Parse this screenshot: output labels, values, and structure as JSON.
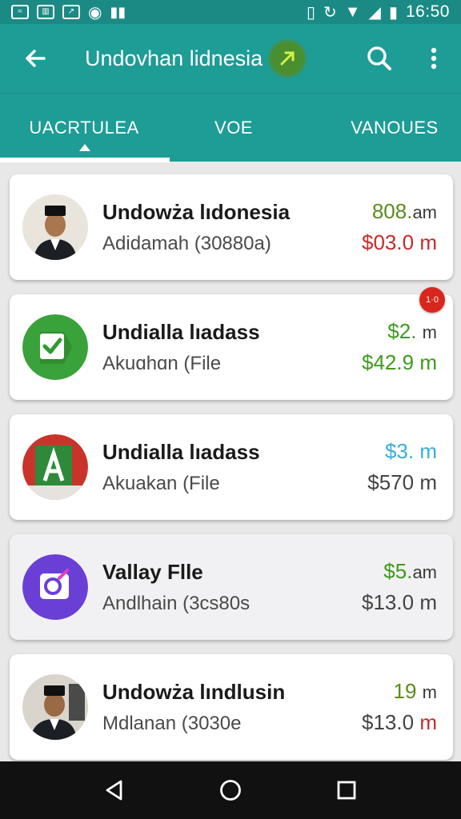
{
  "status_bar": {
    "time": "16:50",
    "left_icons": [
      "notification-icon",
      "newspaper-icon",
      "chart-icon",
      "music-icon",
      "bar-chart-icon"
    ],
    "right_icons": [
      "vibrate-icon",
      "sync-icon",
      "wifi-icon",
      "signal-icon",
      "battery-icon"
    ]
  },
  "app_bar": {
    "title": "Undovhan lidnesia",
    "back_icon": "arrow-left-icon",
    "badge_icon": "arrow-up-right-icon",
    "search_icon": "search-icon",
    "more_icon": "more-vert-icon"
  },
  "tabs": [
    {
      "label": "UACRTULEA",
      "selected": true
    },
    {
      "label": "VOE",
      "selected": false
    },
    {
      "label": "VANOUES",
      "selected": false
    }
  ],
  "list": [
    {
      "title": "Undowża lıdonesia",
      "subtitle": "Adidamah (30880a)",
      "value_top": "808.",
      "value_top_unit": "am",
      "value_bottom": "$03.0",
      "value_bottom_unit": "m",
      "avatar": "person-photo",
      "top_color": "#5b8b1e",
      "bottom_color": "#c92a2a"
    },
    {
      "title": "Undialla lıadass",
      "subtitle": "Akuɑhɑn (File",
      "value_top": "$2.",
      "value_top_unit": "m",
      "value_bottom": "$42.9",
      "value_bottom_unit": "m",
      "avatar": "green-check-icon",
      "badge": "1·0",
      "top_color": "#3f9a1c",
      "bottom_color": "#3f9a1c"
    },
    {
      "title": "Undialla lıadass",
      "subtitle": "Akuakan (File",
      "value_top": "$3.",
      "value_top_unit": "m",
      "value_bottom": "$570",
      "value_bottom_unit": "m",
      "avatar": "flag-letter-icon",
      "top_color": "#3aaed8",
      "bottom_color": "#444444"
    },
    {
      "title": "Vallay Flle",
      "subtitle": "Andlhain (3cs80s",
      "value_top": "$5.",
      "value_top_unit": "am",
      "value_bottom": "$13.0",
      "value_bottom_unit": "m",
      "avatar": "purple-app-icon",
      "top_color": "#3f9a1c",
      "bottom_color": "#444444"
    },
    {
      "title": "Undowża lındlusin",
      "subtitle": "Mdlanan (3030e",
      "value_top": "19",
      "value_top_unit": "m",
      "value_bottom": "$13.0",
      "value_bottom_unit": "m",
      "avatar": "person-photo",
      "top_color": "#5b8b1e",
      "bottom_color": "#444444"
    }
  ],
  "nav_bar": {
    "back_icon": "nav-back-icon",
    "home_icon": "nav-home-icon",
    "recents_icon": "nav-recents-icon"
  }
}
